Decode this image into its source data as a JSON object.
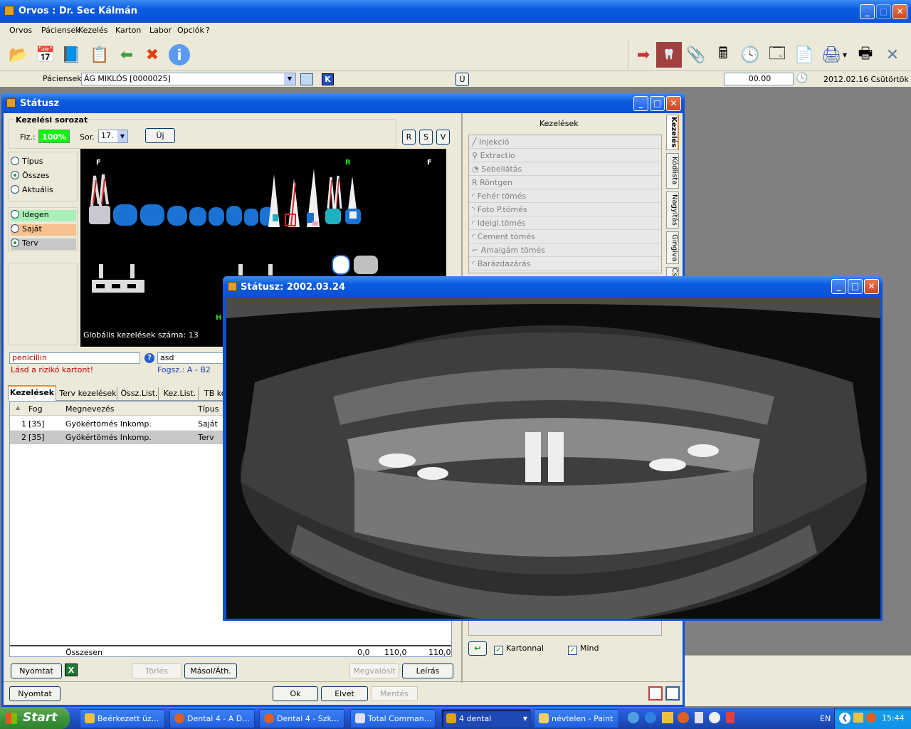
{
  "main_window": {
    "title": "Orvos : Dr. Sec Kálmán"
  },
  "menu": [
    "Orvos",
    "Páciensek",
    "Kezelés",
    "Karton",
    "Labor",
    "Opciók",
    "?"
  ],
  "patient_bar": {
    "label": "Páciensek:",
    "patient": "ÁG MIKLÓS [0000025]",
    "k_btn": "K",
    "u_btn": "Ú",
    "amount": "00.00",
    "date": "2012.02.16 Csütörtök"
  },
  "status_window": {
    "title": "Státusz",
    "series_label": "Kezelési sorozat",
    "fiz_label": "Fiz.:",
    "fiz_value": "100%",
    "sor_label": "Sor.",
    "sor_value": "17.",
    "new_btn": "Új",
    "rsv": [
      "R",
      "S",
      "V"
    ],
    "filter_options": [
      "Típus",
      "Összes",
      "Aktuális"
    ],
    "type_options": [
      "Idegen",
      "Saját",
      "Terv"
    ],
    "chart_labels": {
      "f1": "F",
      "r": "R",
      "f2": "F",
      "h": "H",
      "global": "Globális kezelések száma: 13"
    },
    "allergy": "penicillin",
    "risk_note": "Lásd a rizikó kartont!",
    "note": "asd",
    "fogsz": "Fogsz.: A - B2",
    "tabs": [
      "Kezelések",
      "Terv kezelések",
      "Össz.List.",
      "Kez.List.",
      "TB kód"
    ],
    "table": {
      "headers": [
        "Fog",
        "Megnevezés",
        "Típus"
      ],
      "rows": [
        {
          "n": "1",
          "fog": "[35]",
          "name": "Gyökértömés Inkomp.",
          "type": "Saját"
        },
        {
          "n": "2",
          "fog": "[35]",
          "name": "Gyökértömés Inkomp.",
          "type": "Terv"
        }
      ],
      "total_label": "Összesen",
      "total_values": [
        "0,0",
        "110,0",
        "110,0"
      ]
    },
    "bottom_buttons": {
      "print": "Nyomtat",
      "delete": "Törlés",
      "copy": "Másol/Áth.",
      "realize": "Megvalósít",
      "describe": "Leírás"
    },
    "footer_buttons": {
      "print": "Nyomtat",
      "ok": "Ok",
      "reject": "Elvet",
      "save": "Mentés"
    },
    "right_panel": {
      "title": "Kezelések",
      "items": [
        "Injekció",
        "Extractio",
        "Sebellátás",
        "Röntgen",
        "Fehér tömés",
        "Foto P.tömés",
        "Ideigl.tömés",
        "Cement tömés",
        "Amalgám tömés",
        "Barázdazárás"
      ],
      "vtabs": [
        "Kezelés",
        "Kódlista",
        "Nagyítás",
        "Gingiva",
        "Cs"
      ],
      "check_karton": "Kartonnal",
      "check_mind": "Mind"
    }
  },
  "xray_window": {
    "title": "Státusz: 2002.03.24"
  },
  "taskbar": {
    "start": "Start",
    "items": [
      "Beérkezett üz...",
      "Dental 4 - A D...",
      "Dental 4 - Szk...",
      "Total Comman...",
      "4 dental",
      "névtelen - Paint"
    ],
    "lang": "EN",
    "time": "15:44"
  },
  "colors": {
    "title_blue": "#0a5ae0",
    "fiz_green": "#00ff00",
    "idegen": "#a8f0b8",
    "sajat": "#f8c090",
    "terv": "#c8c8c8"
  }
}
